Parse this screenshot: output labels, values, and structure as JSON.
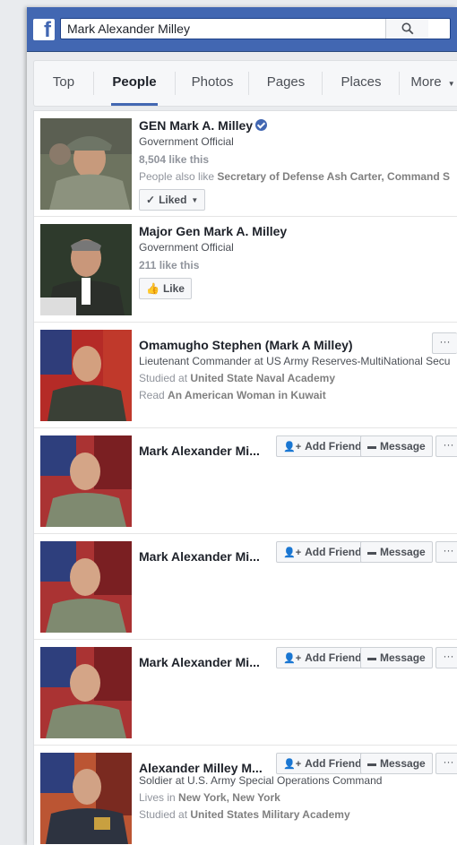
{
  "header": {
    "logo": "f",
    "search_value": "Mark Alexander Milley",
    "search_icon": "search-icon"
  },
  "tabs": [
    {
      "label": "Top"
    },
    {
      "label": "People"
    },
    {
      "label": "Photos"
    },
    {
      "label": "Pages"
    },
    {
      "label": "Places"
    },
    {
      "label": "More"
    }
  ],
  "results": {
    "r1": {
      "name": "GEN Mark A. Milley",
      "category": "Government Official",
      "likes": "8,504 like this",
      "also_prefix": "People also like ",
      "also_names": "Secretary of Defense Ash Carter, Command S",
      "button": "Liked"
    },
    "r2": {
      "name": "Major Gen Mark A. Milley",
      "category": "Government Official",
      "likes": "211 like this",
      "button": "Like"
    },
    "r3": {
      "name": "Omamugho Stephen (Mark A Milley)",
      "job": "Lieutenant Commander at US Army Reserves-MultiNational Secu",
      "studied_prefix": "Studied at ",
      "studied_place": "United State Naval Academy",
      "read_prefix": "Read ",
      "read_title": "An American Woman in Kuwait",
      "more": "···"
    },
    "r4": {
      "name": "Mark Alexander Mi...",
      "add_friend": "Add Friend",
      "message": "Message",
      "more": "···"
    },
    "r5": {
      "name": "Mark Alexander Mi...",
      "add_friend": "Add Friend",
      "message": "Message",
      "more": "···"
    },
    "r6": {
      "name": "Mark Alexander Mi...",
      "add_friend": "Add Friend",
      "message": "Message",
      "more": "···"
    },
    "r7": {
      "name": "Alexander Milley M...",
      "add_friend": "Add Friend",
      "message": "Message",
      "more": "···",
      "job": "Soldier at U.S. Army Special Operations Command",
      "lives_prefix": "Lives in ",
      "lives_place": "New York, New York",
      "studied_prefix": "Studied at ",
      "studied_place": "United States Military Academy"
    }
  },
  "colors": {
    "brand": "#4267b2",
    "background": "#e9ebee"
  }
}
